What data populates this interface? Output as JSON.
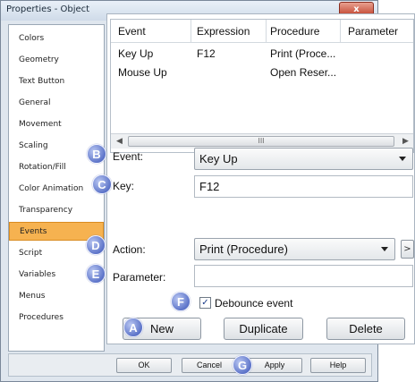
{
  "window": {
    "title": "Properties - Object",
    "close_glyph": "x"
  },
  "categories": [
    {
      "label": "Colors"
    },
    {
      "label": "Geometry"
    },
    {
      "label": "Text Button"
    },
    {
      "label": "General"
    },
    {
      "label": "Movement"
    },
    {
      "label": "Scaling"
    },
    {
      "label": "Rotation/Fill"
    },
    {
      "label": "Color Animation"
    },
    {
      "label": "Transparency"
    },
    {
      "label": "Events",
      "selected": true
    },
    {
      "label": "Script"
    },
    {
      "label": "Variables"
    },
    {
      "label": "Menus"
    },
    {
      "label": "Procedures"
    }
  ],
  "grid": {
    "columns": [
      "Event",
      "Expression",
      "Procedure",
      "Parameter"
    ],
    "rows": [
      [
        "Key Up",
        "F12",
        "Print (Proce...",
        ""
      ],
      [
        "Mouse Up",
        "",
        "Open Reser...",
        ""
      ]
    ],
    "scroll_thumb_glyph": "III"
  },
  "form": {
    "event_label": "Event:",
    "event_value": "Key Up",
    "key_label": "Key:",
    "key_value": "F12",
    "action_label": "Action:",
    "action_value": "Print (Procedure)",
    "more_glyph": ">",
    "parameter_label": "Parameter:",
    "parameter_value": "",
    "debounce_label": "Debounce event",
    "debounce_checked": true,
    "check_glyph": "✓"
  },
  "panel_buttons": {
    "new": "New",
    "duplicate": "Duplicate",
    "delete": "Delete"
  },
  "dialog_buttons": {
    "ok": "OK",
    "cancel": "Cancel",
    "apply": "Apply",
    "help": "Help"
  },
  "callouts": {
    "a": "A",
    "b": "B",
    "c": "C",
    "d": "D",
    "e": "E",
    "f": "F",
    "g": "G"
  },
  "colors": {
    "selected_item": "#f6b250",
    "callout": "#5d74c9",
    "window_bg": "#dfe6ee"
  }
}
